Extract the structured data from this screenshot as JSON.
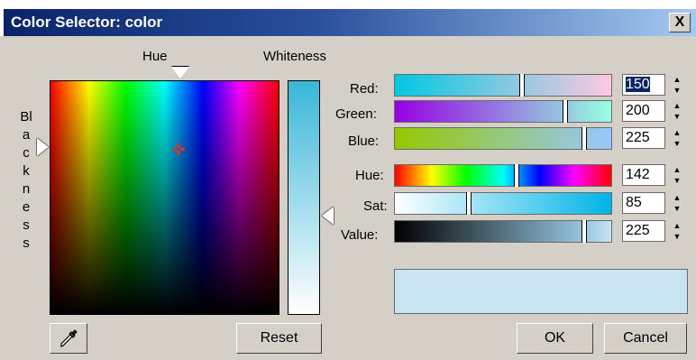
{
  "window": {
    "title": "Color Selector: color",
    "close_label": "X"
  },
  "picker": {
    "hue_label": "Hue",
    "whiteness_label": "Whiteness",
    "blackness_label": "Blackness"
  },
  "rgb": {
    "red_label": "Red:",
    "red_value": "150",
    "green_label": "Green:",
    "green_value": "200",
    "blue_label": "Blue:",
    "blue_value": "225"
  },
  "hsv": {
    "hue_label": "Hue:",
    "hue_value": "142",
    "sat_label": "Sat:",
    "sat_value": "85",
    "value_label": "Value:",
    "value_value": "225"
  },
  "buttons": {
    "reset": "Reset",
    "ok": "OK",
    "cancel": "Cancel"
  },
  "colors": {
    "selected": "#96c8e1",
    "swatch": "#c7e4f0",
    "title_bar": "#0a246a"
  },
  "icons": {
    "eyedropper": "eyedropper-icon"
  }
}
